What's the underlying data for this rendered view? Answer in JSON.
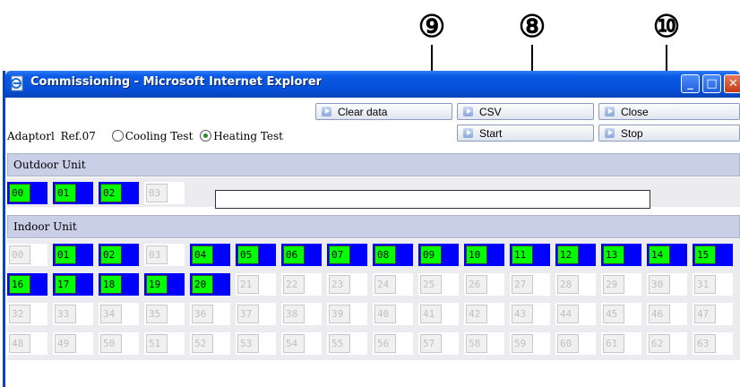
{
  "callouts": [
    {
      "label": "⑨",
      "name": "callout-9"
    },
    {
      "label": "⑧",
      "name": "callout-8"
    },
    {
      "label": "⑩",
      "name": "callout-10"
    }
  ],
  "window": {
    "title": "Commissioning - Microsoft Internet Explorer",
    "icon": "ie-page-icon",
    "controls": {
      "minimize": "_",
      "maximize": "□",
      "close": "✕"
    }
  },
  "toolbar": {
    "clear_data_label": "Clear data",
    "csv_label": "CSV",
    "close_label": "Close",
    "start_label": "Start",
    "stop_label": "Stop"
  },
  "info": {
    "adaptor": "Adaptorl",
    "ref": "Ref.07",
    "cooling_label": "Cooling Test",
    "heating_label": "Heating Test",
    "selected": "Heating Test"
  },
  "outdoor": {
    "heading": "Outdoor Unit",
    "units": [
      {
        "id": "00",
        "active": true
      },
      {
        "id": "01",
        "active": true
      },
      {
        "id": "02",
        "active": true
      },
      {
        "id": "03",
        "active": false
      }
    ],
    "status_text": ""
  },
  "indoor": {
    "heading": "Indoor Unit",
    "rows": [
      [
        {
          "id": "00",
          "active": false
        },
        {
          "id": "01",
          "active": true
        },
        {
          "id": "02",
          "active": true
        },
        {
          "id": "03",
          "active": false
        },
        {
          "id": "04",
          "active": true
        },
        {
          "id": "05",
          "active": true
        },
        {
          "id": "06",
          "active": true
        },
        {
          "id": "07",
          "active": true
        },
        {
          "id": "08",
          "active": true
        },
        {
          "id": "09",
          "active": true
        },
        {
          "id": "10",
          "active": true
        },
        {
          "id": "11",
          "active": true
        },
        {
          "id": "12",
          "active": true
        },
        {
          "id": "13",
          "active": true
        },
        {
          "id": "14",
          "active": true
        },
        {
          "id": "15",
          "active": true
        }
      ],
      [
        {
          "id": "16",
          "active": true
        },
        {
          "id": "17",
          "active": true
        },
        {
          "id": "18",
          "active": true
        },
        {
          "id": "19",
          "active": true
        },
        {
          "id": "20",
          "active": true
        },
        {
          "id": "21",
          "active": false
        },
        {
          "id": "22",
          "active": false
        },
        {
          "id": "23",
          "active": false
        },
        {
          "id": "24",
          "active": false
        },
        {
          "id": "25",
          "active": false
        },
        {
          "id": "26",
          "active": false
        },
        {
          "id": "27",
          "active": false
        },
        {
          "id": "28",
          "active": false
        },
        {
          "id": "29",
          "active": false
        },
        {
          "id": "30",
          "active": false
        },
        {
          "id": "31",
          "active": false
        }
      ],
      [
        {
          "id": "32",
          "active": false
        },
        {
          "id": "33",
          "active": false
        },
        {
          "id": "34",
          "active": false
        },
        {
          "id": "35",
          "active": false
        },
        {
          "id": "36",
          "active": false
        },
        {
          "id": "37",
          "active": false
        },
        {
          "id": "38",
          "active": false
        },
        {
          "id": "39",
          "active": false
        },
        {
          "id": "40",
          "active": false
        },
        {
          "id": "41",
          "active": false
        },
        {
          "id": "42",
          "active": false
        },
        {
          "id": "43",
          "active": false
        },
        {
          "id": "44",
          "active": false
        },
        {
          "id": "45",
          "active": false
        },
        {
          "id": "46",
          "active": false
        },
        {
          "id": "47",
          "active": false
        }
      ],
      [
        {
          "id": "48",
          "active": false
        },
        {
          "id": "49",
          "active": false
        },
        {
          "id": "50",
          "active": false
        },
        {
          "id": "51",
          "active": false
        },
        {
          "id": "52",
          "active": false
        },
        {
          "id": "53",
          "active": false
        },
        {
          "id": "54",
          "active": false
        },
        {
          "id": "55",
          "active": false
        },
        {
          "id": "56",
          "active": false
        },
        {
          "id": "57",
          "active": false
        },
        {
          "id": "58",
          "active": false
        },
        {
          "id": "59",
          "active": false
        },
        {
          "id": "60",
          "active": false
        },
        {
          "id": "61",
          "active": false
        },
        {
          "id": "62",
          "active": false
        },
        {
          "id": "63",
          "active": false
        }
      ]
    ]
  },
  "colors": {
    "active_fill": "#00ff00",
    "active_bar": "#0000ff",
    "titlebar": "#0a5ae6",
    "section_header": "#c8cfe6"
  }
}
